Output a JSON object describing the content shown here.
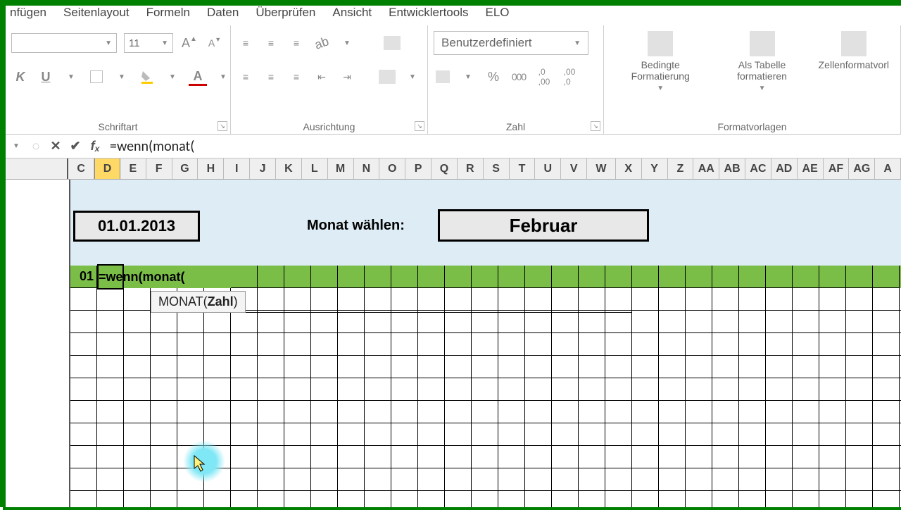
{
  "tabs": [
    "nfügen",
    "Seitenlayout",
    "Formeln",
    "Daten",
    "Überprüfen",
    "Ansicht",
    "Entwicklertools",
    "ELO"
  ],
  "ribbon": {
    "font_group": "Schriftart",
    "font_size": "11",
    "align_group": "Ausrichtung",
    "number_group": "Zahl",
    "number_format": "Benutzerdefiniert",
    "styles_group": "Formatvorlagen",
    "cond_fmt": "Bedingte Formatierung",
    "as_table": "Als Tabelle formatieren",
    "cell_styles": "Zellenformatvorl"
  },
  "formula_bar": {
    "text": "=wenn(monat("
  },
  "columns": [
    "C",
    "D",
    "E",
    "F",
    "G",
    "H",
    "I",
    "J",
    "K",
    "L",
    "M",
    "N",
    "O",
    "P",
    "Q",
    "R",
    "S",
    "T",
    "U",
    "V",
    "W",
    "X",
    "Y",
    "Z",
    "AA",
    "AB",
    "AC",
    "AD",
    "AE",
    "AF",
    "AG",
    "A"
  ],
  "active_col": "D",
  "sheet": {
    "date_value": "01.01.2013",
    "month_label": "Monat wählen:",
    "month_value": "Februar",
    "row_c_value": "01",
    "editing_formula": "=wenn(monat(",
    "fn_tip_prefix": "MONAT(",
    "fn_tip_bold": "Zahl",
    "fn_tip_suffix": ")"
  }
}
